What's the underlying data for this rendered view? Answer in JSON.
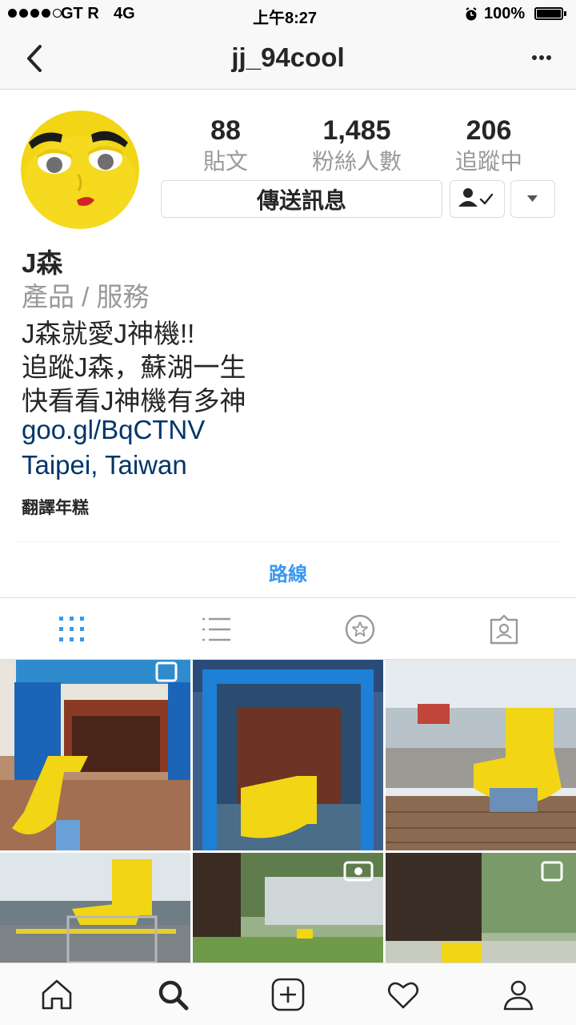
{
  "status_bar": {
    "carrier": "GT R",
    "network": "4G",
    "time": "上午8:27",
    "battery": "100%",
    "battery_level": 1.0
  },
  "nav": {
    "title": "jj_94cool",
    "back_icon": "chevron-left-icon",
    "more_icon": "more-horizontal-icon"
  },
  "profile": {
    "stats": [
      {
        "value": "88",
        "label": "貼文"
      },
      {
        "value": "1,485",
        "label": "粉絲人數"
      },
      {
        "value": "206",
        "label": "追蹤中"
      }
    ],
    "message_button": "傳送訊息",
    "name": "J森",
    "category": "產品 / 服務",
    "bio_lines": [
      "J森就愛J神機!!",
      "追蹤J森，蘇湖一生",
      "快看看J神機有多神"
    ],
    "link": "goo.gl/BqCTNV",
    "location": "Taipei, Taiwan",
    "translate": "翻譯年糕",
    "directions": "路線"
  },
  "tabs": [
    "grid-icon",
    "list-icon",
    "saved-star-icon",
    "tagged-icon"
  ],
  "bottom_nav": [
    "home-icon",
    "search-icon",
    "add-icon",
    "heart-icon",
    "profile-icon"
  ],
  "colors": {
    "link": "#003569",
    "accent": "#3897f0",
    "muted": "#999999",
    "character_yellow": "#f2d515"
  }
}
